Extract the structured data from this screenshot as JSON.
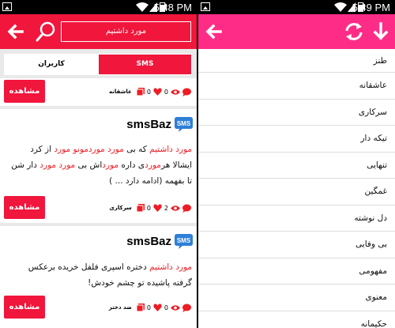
{
  "left": {
    "status_time": "5:48 PM",
    "search_text": "مورد داشتیم",
    "tabs": {
      "users": "کاربران",
      "sms": "SMS"
    },
    "view_label": "مشاهده",
    "cards": [
      {
        "category": "عاشقانه",
        "views": "0",
        "likes": "0"
      },
      {
        "title": "smsBaz",
        "category": "سرکاری",
        "views": "2",
        "likes": "0",
        "line1": [
          "مورد داشتیم",
          " که بی ",
          "مورد موردمونو",
          " ",
          "مورد",
          " از کرد"
        ],
        "line2": [
          "ایشالا هر",
          "مورد",
          "ی داره ",
          "مورد",
          "اش بی ",
          "مورد مورد",
          " دار شن"
        ],
        "line3": "تا بفهمه (ادامه دارد ... )"
      },
      {
        "title": "smsBaz",
        "category": "ضد دختر",
        "views": "0",
        "likes": "0",
        "line1": [
          "مورد داشتیم",
          " دختره اسپری فلفل خریده برعکس"
        ],
        "line2": "گرفته پاشیده تو چشم خودش!"
      }
    ]
  },
  "right": {
    "status_time": "5:49 PM",
    "menu": [
      "طنز",
      "عاشقانه",
      "سرکاری",
      "تیکه دار",
      "تنهایی",
      "غمگین",
      "دل نوشته",
      "بی وفایی",
      "مفهومی",
      "معنوی",
      "حکیمانه"
    ]
  },
  "colors": {
    "left_accent": "#f0163c",
    "right_accent": "#ff2c87",
    "highlight": "#ee1c24"
  }
}
